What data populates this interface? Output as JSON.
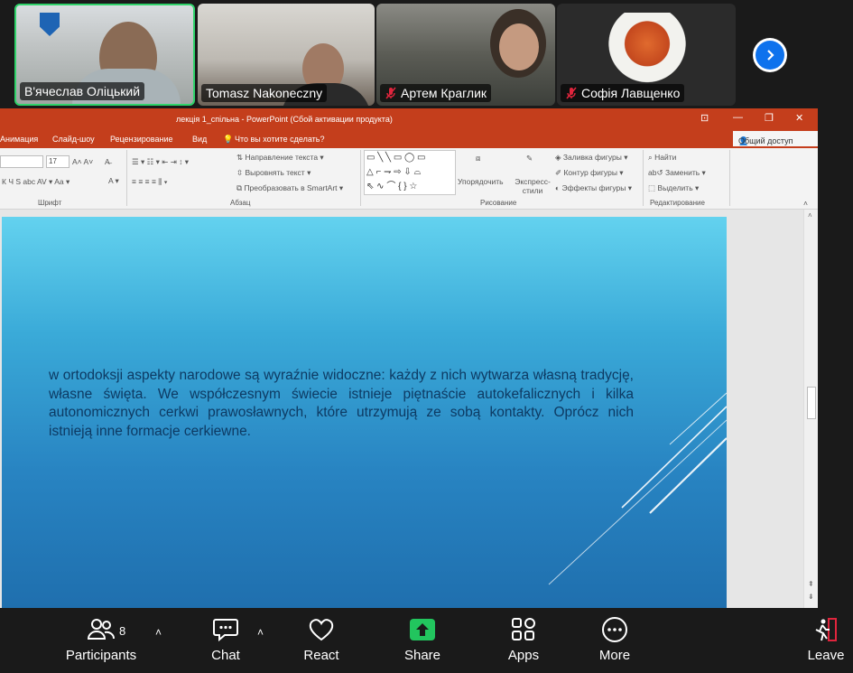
{
  "participants": [
    {
      "name": "В'ячеслав Оліцький",
      "muted": false,
      "speaking": true
    },
    {
      "name": "Tomasz Nakoneczny",
      "muted": false,
      "speaking": false
    },
    {
      "name": "Артем Краглик",
      "muted": true,
      "speaking": false
    },
    {
      "name": "Софія Лавщенко",
      "muted": true,
      "speaking": false
    }
  ],
  "powerpoint": {
    "window_title": "лекція 1_спільна - PowerPoint (Сбой активации продукта)",
    "menu": [
      "Анимация",
      "Слайд-шоу",
      "Рецензирование",
      "Вид"
    ],
    "tell_me": "Что вы хотите сделать?",
    "share": "Общий доступ",
    "font_size": "17",
    "groups": {
      "font": "Шрифт",
      "paragraph": "Абзац",
      "drawing": "Рисование",
      "editing": "Редактирование"
    },
    "paragraph_items": {
      "text_direction": "Направление текста",
      "align_text": "Выровнять текст",
      "smartart": "Преобразовать в SmartArt"
    },
    "drawing_items": {
      "arrange": "Упорядочить",
      "quick_styles": "Экспресс-стили",
      "shape_fill": "Заливка фигуры",
      "shape_outline": "Контур фигуры",
      "shape_effects": "Эффекты фигуры"
    },
    "editing_items": {
      "find": "Найти",
      "replace": "Заменить",
      "select": "Выделить"
    },
    "slide_text": "w ortodoksji aspekty narodowe są wyraźnie widoczne: każdy z nich wytwarza własną tradycję, własne święta. We współczesnym świecie istnieje piętnaście autokefalicznych i kilka autonomicznych cerkwi prawosławnych, które utrzymują ze sobą kontakty. Oprócz nich istnieją inne formacje cerkiewne."
  },
  "toolbar": {
    "participants_label": "Participants",
    "participants_count": "8",
    "chat_label": "Chat",
    "react_label": "React",
    "share_label": "Share",
    "apps_label": "Apps",
    "more_label": "More",
    "leave_label": "Leave"
  },
  "colors": {
    "zoom_blue": "#0e72ed",
    "share_green": "#22c55e",
    "ppt_red": "#c43e1c",
    "active_speaker": "#2fd36a"
  }
}
